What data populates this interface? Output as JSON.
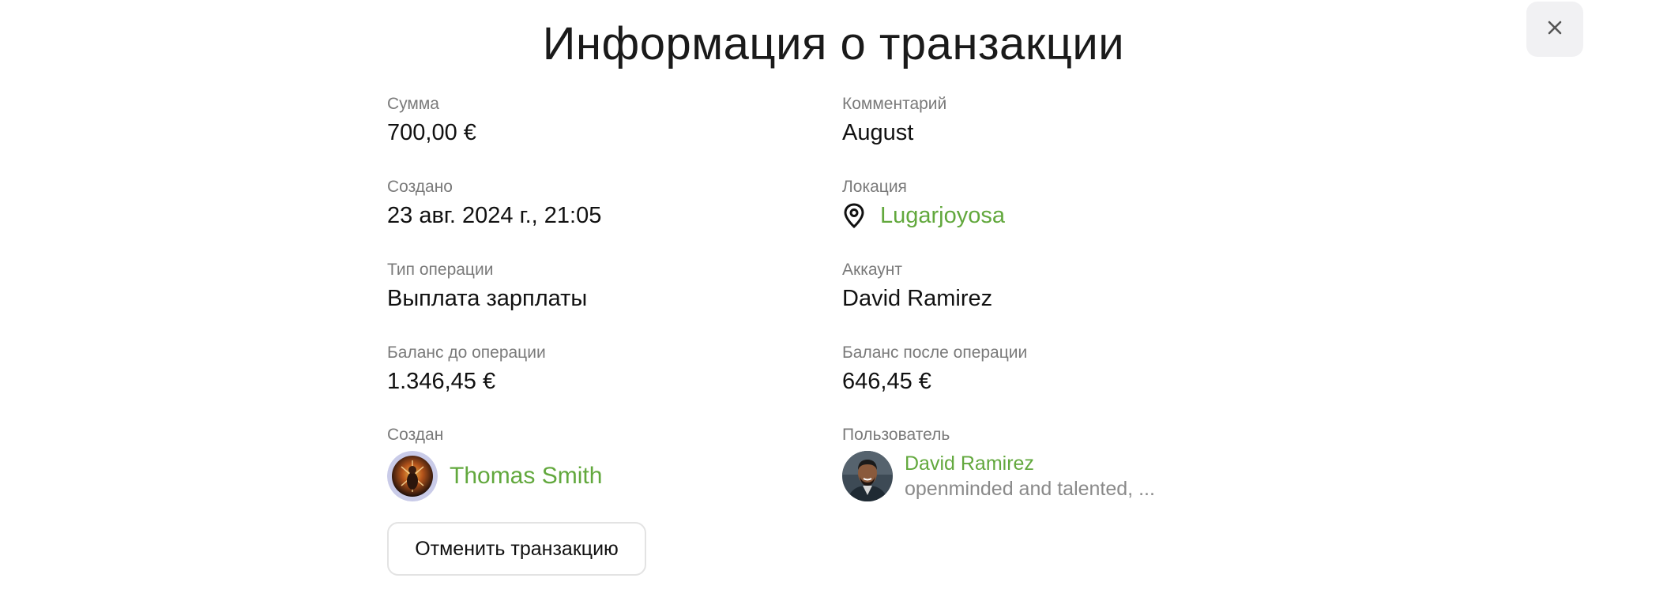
{
  "dialog": {
    "title": "Информация о транзакции"
  },
  "fields": {
    "amount": {
      "label": "Сумма",
      "value": "700,00 €"
    },
    "comment": {
      "label": "Комментарий",
      "value": "August"
    },
    "created_at": {
      "label": "Создано",
      "value": "23 авг. 2024 г., 21:05"
    },
    "location": {
      "label": "Локация",
      "value": "Lugarjoyosa",
      "icon": "location-pin-icon"
    },
    "operation_type": {
      "label": "Тип операции",
      "value": "Выплата зарплаты"
    },
    "account": {
      "label": "Аккаунт",
      "value": "David Ramirez"
    },
    "balance_before": {
      "label": "Баланс до операции",
      "value": "1.346,45 €"
    },
    "balance_after": {
      "label": "Баланс после операции",
      "value": "646,45 €"
    },
    "created_by": {
      "label": "Создан",
      "name": "Thomas Smith"
    },
    "user": {
      "label": "Пользователь",
      "name": "David Ramirez",
      "description": "openminded and talented, ..."
    }
  },
  "actions": {
    "cancel_label": "Отменить транзакцию",
    "close_icon": "close-icon"
  },
  "colors": {
    "accent": "#62a83d",
    "label": "#7a7a7a",
    "text": "#111111",
    "close_bg": "#f1f1f3"
  }
}
